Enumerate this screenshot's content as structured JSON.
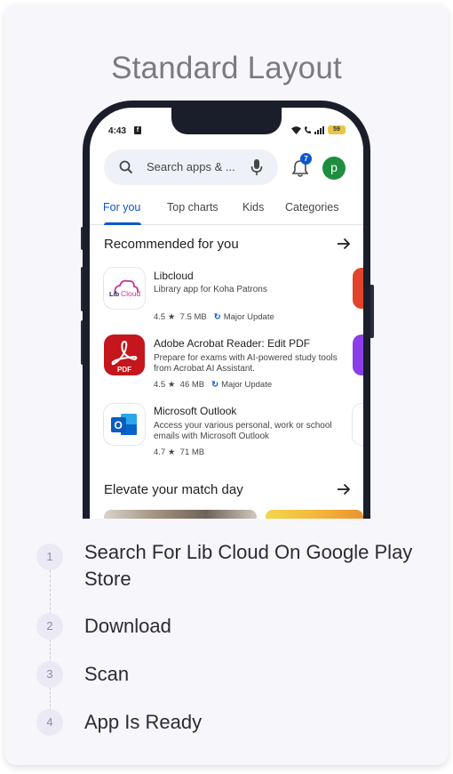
{
  "card": {
    "title": "Standard Layout"
  },
  "phone": {
    "status": {
      "time": "4:43",
      "battery": "59"
    },
    "search": {
      "placeholder": "Search apps & ...",
      "notification_count": "7",
      "avatar_letter": "p"
    },
    "tabs": [
      {
        "label": "For you",
        "active": true
      },
      {
        "label": "Top charts"
      },
      {
        "label": "Kids"
      },
      {
        "label": "Categories"
      }
    ],
    "recommended": {
      "title": "Recommended for you",
      "apps": [
        {
          "name": "Libcloud",
          "description": "Library app for Koha Patrons",
          "rating": "4.5",
          "size": "7.5 MB",
          "update": "Major Update",
          "icon": "libcloud-logo-icon"
        },
        {
          "name": "Adobe Acrobat Reader: Edit PDF",
          "description": "Prepare for exams with AI-powered study tools from Acrobat AI Assistant.",
          "rating": "4.5",
          "size": "46 MB",
          "update": "Major Update",
          "icon": "adobe-acrobat-icon"
        },
        {
          "name": "Microsoft Outlook",
          "description": "Access your various personal, work or school emails with Microsoft Outlook",
          "rating": "4.7",
          "size": "71 MB",
          "icon": "outlook-icon"
        }
      ]
    },
    "match_day": {
      "title": "Elevate your match day"
    },
    "colors": {
      "accent": "#0b57d0",
      "adobe_red": "#c4161c",
      "outlook_blue": "#0a64c8"
    }
  },
  "steps": [
    {
      "number": "1",
      "label": "Search For Lib Cloud On Google Play Store"
    },
    {
      "number": "2",
      "label": "Download"
    },
    {
      "number": "3",
      "label": "Scan"
    },
    {
      "number": "4",
      "label": "App Is Ready"
    }
  ]
}
